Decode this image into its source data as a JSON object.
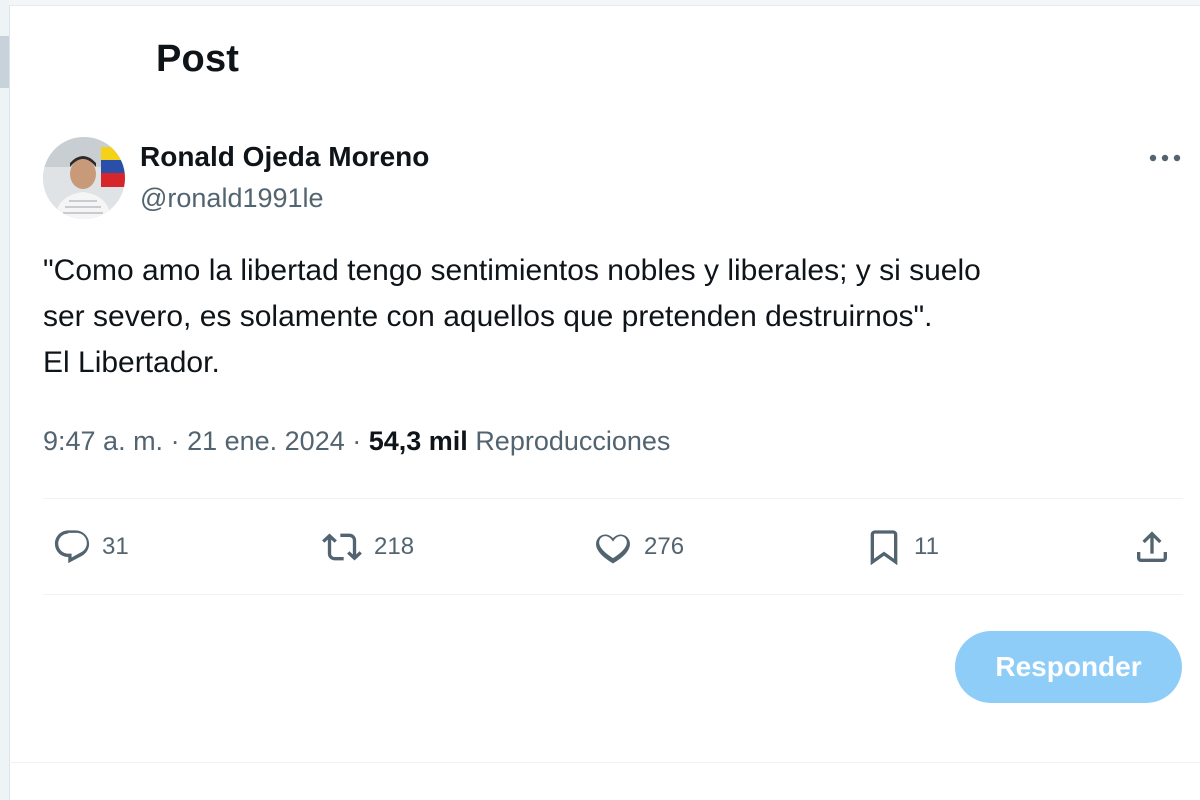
{
  "header": {
    "title": "Post"
  },
  "post": {
    "author": {
      "name": "Ronald Ojeda Moreno",
      "handle": "@ronald1991le",
      "avatar_icon": "profile-photo"
    },
    "text_lines": [
      "\"Como amo la libertad tengo sentimientos nobles y liberales; y si suelo",
      "ser severo, es solamente con aquellos que pretenden destruirnos\".",
      "El Libertador."
    ],
    "meta": {
      "time": "9:47 a. m.",
      "separator": " · ",
      "date": "21 ene. 2024",
      "views_count": "54,3 mil",
      "views_label": "Reproducciones"
    },
    "stats": {
      "replies": "31",
      "reposts": "218",
      "likes": "276",
      "bookmarks": "11"
    },
    "icons": {
      "reply": "reply-icon",
      "repost": "repost-icon",
      "like": "heart-icon",
      "bookmark": "bookmark-icon",
      "share": "share-icon",
      "more": "more-icon"
    }
  },
  "composer": {
    "reply_button_label": "Responder"
  },
  "colors": {
    "text_primary": "#0f1419",
    "text_secondary": "#536471",
    "reply_button_disabled": "#8ecdf8",
    "divider": "#eff3f4"
  }
}
